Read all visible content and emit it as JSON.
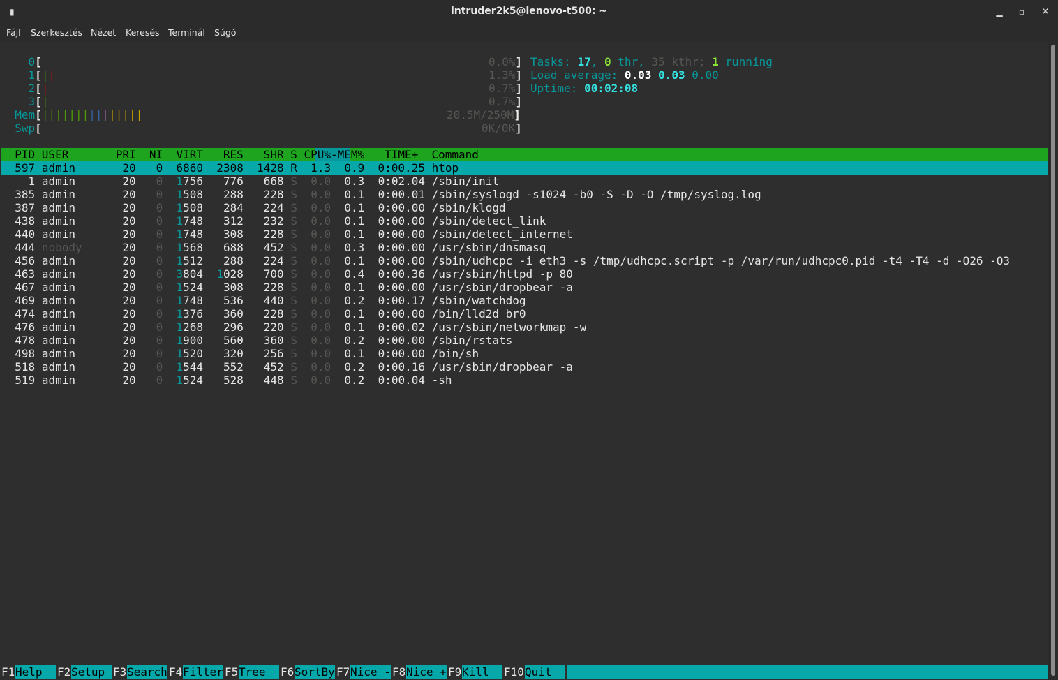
{
  "window": {
    "title": "intruder2k5@lenovo-t500: ~",
    "menu_icon": "▮",
    "min_icon": "▁",
    "max_icon": "▫",
    "close_icon": "✕"
  },
  "menu": {
    "file": "Fájl",
    "edit": "Szerkesztés",
    "view": "Nézet",
    "search": "Keresés",
    "terminal": "Terminál",
    "help": "Súgó"
  },
  "meters": {
    "cpu0": {
      "label": "0",
      "value": "0.0%"
    },
    "cpu1": {
      "label": "1",
      "value": "1.3%"
    },
    "cpu2": {
      "label": "2",
      "value": "0.7%"
    },
    "cpu3": {
      "label": "3",
      "value": "0.7%"
    },
    "mem": {
      "label": "Mem",
      "value": "20.5M/250M"
    },
    "swp": {
      "label": "Swp",
      "value": "0K/0K"
    }
  },
  "summary": {
    "tasks_label": "Tasks:",
    "tasks": "17",
    "thr": "0",
    "thr_label": "thr,",
    "kthr_text": "35 kthr;",
    "running": "1",
    "running_label": "running",
    "load_label": "Load average:",
    "load1": "0.03",
    "load5": "0.03",
    "load15": "0.00",
    "uptime_label": "Uptime:",
    "uptime": "00:02:08"
  },
  "table": {
    "columns": [
      "PID",
      "USER",
      "PRI",
      "NI",
      "VIRT",
      "RES",
      "SHR",
      "S",
      "CPU%",
      "MEM%",
      "TIME+",
      "Command"
    ],
    "header_text": "  PID USER       PRI  NI  VIRT   RES   SHR S CPU%-MEM%   TIME+  Command",
    "rows": [
      {
        "pid": "597",
        "user": "admin",
        "pri": "20",
        "ni": "0",
        "virt": "6860",
        "res": "2308",
        "shr": "1428",
        "s": "R",
        "cpu": "1.3",
        "mem": "0.9",
        "time": "0:00.25",
        "cmd": "htop"
      },
      {
        "pid": "1",
        "user": "admin",
        "pri": "20",
        "ni": "0",
        "virt": "1756",
        "res": "776",
        "shr": "668",
        "s": "S",
        "cpu": "0.0",
        "mem": "0.3",
        "time": "0:02.04",
        "cmd": "/sbin/init"
      },
      {
        "pid": "385",
        "user": "admin",
        "pri": "20",
        "ni": "0",
        "virt": "1508",
        "res": "288",
        "shr": "228",
        "s": "S",
        "cpu": "0.0",
        "mem": "0.1",
        "time": "0:00.01",
        "cmd": "/sbin/syslogd -s1024 -b0 -S -D -O /tmp/syslog.log"
      },
      {
        "pid": "387",
        "user": "admin",
        "pri": "20",
        "ni": "0",
        "virt": "1508",
        "res": "284",
        "shr": "224",
        "s": "S",
        "cpu": "0.0",
        "mem": "0.1",
        "time": "0:00.00",
        "cmd": "/sbin/klogd"
      },
      {
        "pid": "438",
        "user": "admin",
        "pri": "20",
        "ni": "0",
        "virt": "1748",
        "res": "312",
        "shr": "232",
        "s": "S",
        "cpu": "0.0",
        "mem": "0.1",
        "time": "0:00.00",
        "cmd": "/sbin/detect_link"
      },
      {
        "pid": "440",
        "user": "admin",
        "pri": "20",
        "ni": "0",
        "virt": "1748",
        "res": "308",
        "shr": "228",
        "s": "S",
        "cpu": "0.0",
        "mem": "0.1",
        "time": "0:00.00",
        "cmd": "/sbin/detect_internet"
      },
      {
        "pid": "444",
        "user": "nobody",
        "pri": "20",
        "ni": "0",
        "virt": "1568",
        "res": "688",
        "shr": "452",
        "s": "S",
        "cpu": "0.0",
        "mem": "0.3",
        "time": "0:00.00",
        "cmd": "/usr/sbin/dnsmasq"
      },
      {
        "pid": "456",
        "user": "admin",
        "pri": "20",
        "ni": "0",
        "virt": "1512",
        "res": "288",
        "shr": "224",
        "s": "S",
        "cpu": "0.0",
        "mem": "0.1",
        "time": "0:00.00",
        "cmd": "/sbin/udhcpc -i eth3 -s /tmp/udhcpc.script -p /var/run/udhcpc0.pid -t4 -T4 -d -O26 -O3"
      },
      {
        "pid": "463",
        "user": "admin",
        "pri": "20",
        "ni": "0",
        "virt": "3804",
        "res": "1028",
        "shr": "700",
        "s": "S",
        "cpu": "0.0",
        "mem": "0.4",
        "time": "0:00.36",
        "cmd": "/usr/sbin/httpd -p 80"
      },
      {
        "pid": "467",
        "user": "admin",
        "pri": "20",
        "ni": "0",
        "virt": "1524",
        "res": "308",
        "shr": "228",
        "s": "S",
        "cpu": "0.0",
        "mem": "0.1",
        "time": "0:00.00",
        "cmd": "/usr/sbin/dropbear -a"
      },
      {
        "pid": "469",
        "user": "admin",
        "pri": "20",
        "ni": "0",
        "virt": "1748",
        "res": "536",
        "shr": "440",
        "s": "S",
        "cpu": "0.0",
        "mem": "0.2",
        "time": "0:00.17",
        "cmd": "/sbin/watchdog"
      },
      {
        "pid": "474",
        "user": "admin",
        "pri": "20",
        "ni": "0",
        "virt": "1376",
        "res": "360",
        "shr": "228",
        "s": "S",
        "cpu": "0.0",
        "mem": "0.1",
        "time": "0:00.00",
        "cmd": "/bin/lld2d br0"
      },
      {
        "pid": "476",
        "user": "admin",
        "pri": "20",
        "ni": "0",
        "virt": "1268",
        "res": "296",
        "shr": "220",
        "s": "S",
        "cpu": "0.0",
        "mem": "0.1",
        "time": "0:00.02",
        "cmd": "/usr/sbin/networkmap -w"
      },
      {
        "pid": "478",
        "user": "admin",
        "pri": "20",
        "ni": "0",
        "virt": "1900",
        "res": "560",
        "shr": "360",
        "s": "S",
        "cpu": "0.0",
        "mem": "0.2",
        "time": "0:00.00",
        "cmd": "/sbin/rstats"
      },
      {
        "pid": "498",
        "user": "admin",
        "pri": "20",
        "ni": "0",
        "virt": "1520",
        "res": "320",
        "shr": "256",
        "s": "S",
        "cpu": "0.0",
        "mem": "0.1",
        "time": "0:00.00",
        "cmd": "/bin/sh"
      },
      {
        "pid": "518",
        "user": "admin",
        "pri": "20",
        "ni": "0",
        "virt": "1544",
        "res": "552",
        "shr": "452",
        "s": "S",
        "cpu": "0.0",
        "mem": "0.2",
        "time": "0:00.16",
        "cmd": "/usr/sbin/dropbear -a"
      },
      {
        "pid": "519",
        "user": "admin",
        "pri": "20",
        "ni": "0",
        "virt": "1524",
        "res": "528",
        "shr": "448",
        "s": "S",
        "cpu": "0.0",
        "mem": "0.2",
        "time": "0:00.04",
        "cmd": "-sh"
      }
    ]
  },
  "footer": [
    {
      "key": "F1",
      "label": "Help  "
    },
    {
      "key": "F2",
      "label": "Setup "
    },
    {
      "key": "F3",
      "label": "Search"
    },
    {
      "key": "F4",
      "label": "Filter"
    },
    {
      "key": "F5",
      "label": "Tree  "
    },
    {
      "key": "F6",
      "label": "SortBy"
    },
    {
      "key": "F7",
      "label": "Nice -"
    },
    {
      "key": "F8",
      "label": "Nice +"
    },
    {
      "key": "F9",
      "label": "Kill  "
    },
    {
      "key": "F10",
      "label": "Quit  "
    }
  ],
  "colors": {
    "header_bg": "#1ea41e",
    "selection_bg": "#06a8aa",
    "accent_cyan": "#06989a"
  }
}
